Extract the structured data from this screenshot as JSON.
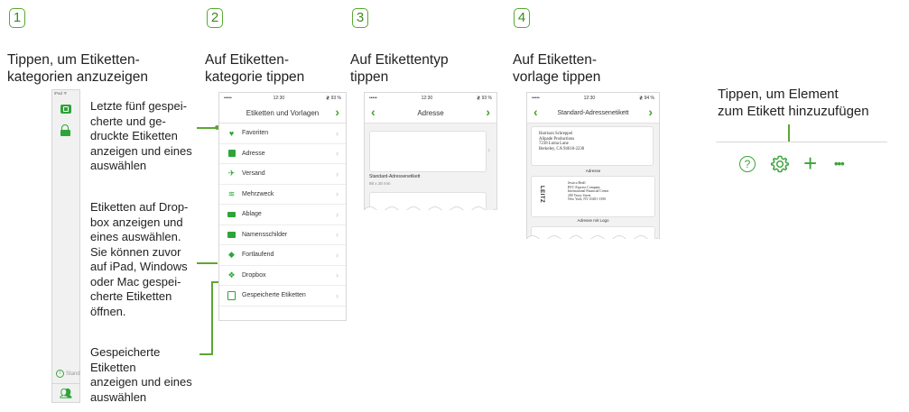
{
  "steps": [
    {
      "num": "1",
      "title_l1": "Tippen, um Etiketten-",
      "title_l2": "kategorien anzuzeigen"
    },
    {
      "num": "2",
      "title_l1": "Auf Etiketten-",
      "title_l2": "kategorie tippen"
    },
    {
      "num": "3",
      "title_l1": "Auf Etikettentyp",
      "title_l2": "tippen"
    },
    {
      "num": "4",
      "title_l1": "Auf Etiketten-",
      "title_l2": "vorlage tippen"
    }
  ],
  "step5": {
    "l1": "Tippen, um Element",
    "l2": "zum Etikett hinzuzufügen"
  },
  "notes": {
    "recent": [
      "Letzte fünf gespei-",
      "cherte und ge-",
      "druckte Etiketten",
      "anzeigen und eines",
      "auswählen"
    ],
    "dropbox": [
      "Etiketten auf Drop-",
      "box anzeigen und",
      "eines auswählen.",
      "Sie können zuvor",
      "auf iPad, Windows",
      "oder Mac gespei-",
      "cherte Etiketten",
      "öffnen."
    ],
    "saved": [
      "Gespeicherte",
      "Etiketten",
      "anzeigen und eines",
      "auswählen"
    ]
  },
  "sidebar": {
    "status": "iPad ᯤ",
    "bottom_label": "Stand"
  },
  "screen2": {
    "status_left": "•••••",
    "status_time": "12:30",
    "status_right": "≹ 93 %",
    "title": "Etiketten und Vorlagen",
    "rows": [
      "Favoriten",
      "Adresse",
      "Versand",
      "Mehrzweck",
      "Ablage",
      "Namensschilder",
      "Fortlaufend",
      "Dropbox",
      "Gespeicherte Etiketten"
    ]
  },
  "screen3": {
    "status_left": "•••••",
    "status_time": "12:30",
    "status_right": "≹ 93 %",
    "title": "Adresse",
    "label_name": "Standard-Adressenetikett",
    "label_size": "88 x 28 mm"
  },
  "screen4": {
    "status_left": "•••••",
    "status_time": "12:30",
    "status_right": "≹ 94 %",
    "title": "Standard-Adressenetikett",
    "addr1": [
      "Harrison Schreppel",
      "Alipade Productions",
      "7238 Loma Lane",
      "Berkeley, CA 94618-2230"
    ],
    "caption1": "Adresse",
    "logo": "LEITZ",
    "addr2": [
      "Jessica Beall",
      "BTC Express Company",
      "International Financial Center",
      "200 Vesey Street",
      "New York, NY 10281-1390"
    ],
    "caption2": "Adresse mit Logo"
  },
  "toolbar": {
    "help": "?",
    "settings": "settings-icon",
    "add": "+",
    "more": "•••"
  },
  "colors": {
    "accent": "#5aa832",
    "icon": "#2ea43a"
  }
}
